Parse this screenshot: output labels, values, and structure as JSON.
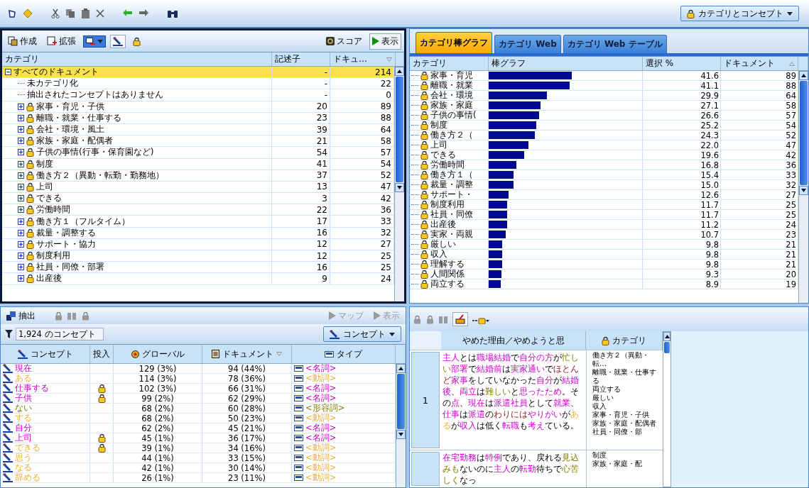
{
  "toolbar": {
    "view_menu": {
      "label": "カテゴリとコンセプト"
    }
  },
  "categories_pane": {
    "buttons": [
      {
        "label": "作成"
      },
      {
        "label": "拡張"
      }
    ],
    "right_buttons": [
      {
        "label": "スコア",
        "kind": "score"
      },
      {
        "label": "表示",
        "kind": "play"
      }
    ],
    "columns": [
      "カテゴリ",
      "記述子",
      "ドキュ…"
    ],
    "tree": [
      {
        "kind": "root",
        "label": "すべてのドキュメント",
        "descriptors": "-",
        "documents": "214",
        "expanded": true,
        "selected": true,
        "children": [
          {
            "kind": "plain",
            "label": "未カテゴリ化",
            "descriptors": "-",
            "documents": "22",
            "selected": false
          },
          {
            "kind": "plain",
            "label": "抽出されたコンセプトはありません",
            "descriptors": "-",
            "documents": "0",
            "selected": false
          },
          {
            "kind": "category",
            "label": "家事・育児・子供",
            "descriptors": "20",
            "documents": "89",
            "expanded": false,
            "selected": false
          },
          {
            "kind": "category",
            "label": "離職・就業・仕事する",
            "descriptors": "23",
            "documents": "88",
            "expanded": false,
            "selected": false
          },
          {
            "kind": "category",
            "label": "会社・環境・風土",
            "descriptors": "39",
            "documents": "64",
            "expanded": false,
            "selected": false
          },
          {
            "kind": "category",
            "label": "家族・家庭・配偶者",
            "descriptors": "21",
            "documents": "58",
            "expanded": false,
            "selected": false
          },
          {
            "kind": "category",
            "label": "子供の事情(行事・保育園など)",
            "descriptors": "54",
            "documents": "57",
            "expanded": false,
            "selected": false
          },
          {
            "kind": "category",
            "label": "制度",
            "descriptors": "41",
            "documents": "54",
            "expanded": false,
            "selected": false
          },
          {
            "kind": "category",
            "label": "働き方２（異動・転勤・勤務地）",
            "descriptors": "37",
            "documents": "52",
            "expanded": false,
            "selected": false
          },
          {
            "kind": "category",
            "label": "上司",
            "descriptors": "13",
            "documents": "47",
            "expanded": false,
            "selected": false
          },
          {
            "kind": "category",
            "label": "できる",
            "descriptors": "3",
            "documents": "42",
            "expanded": false,
            "selected": false
          },
          {
            "kind": "category",
            "label": "労働時間",
            "descriptors": "22",
            "documents": "36",
            "expanded": false,
            "selected": false
          },
          {
            "kind": "category",
            "label": "働き方１（フルタイム）",
            "descriptors": "17",
            "documents": "33",
            "expanded": false,
            "selected": false
          },
          {
            "kind": "category",
            "label": "裁量・調整する",
            "descriptors": "16",
            "documents": "32",
            "expanded": false,
            "selected": false
          },
          {
            "kind": "category",
            "label": "サポート・協力",
            "descriptors": "12",
            "documents": "27",
            "expanded": false,
            "selected": false
          },
          {
            "kind": "category",
            "label": "制度利用",
            "descriptors": "12",
            "documents": "25",
            "expanded": false,
            "selected": false
          },
          {
            "kind": "category",
            "label": "社員・同僚・部署",
            "descriptors": "16",
            "documents": "25",
            "expanded": false,
            "selected": false
          },
          {
            "kind": "category",
            "label": "出産後",
            "descriptors": "9",
            "documents": "24",
            "expanded": false,
            "selected": false
          }
        ]
      }
    ]
  },
  "chart_pane": {
    "tabs": [
      {
        "label": "カテゴリ棒グラフ",
        "selected": true
      },
      {
        "label": "カテゴリ Web",
        "selected": false
      },
      {
        "label": "カテゴリ Web テーブル",
        "selected": false
      }
    ],
    "columns": [
      "カテゴリ",
      "棒グラフ",
      "選択 %",
      "ドキュメント"
    ],
    "rows": [
      {
        "label": "家事・育児",
        "level": 0.54,
        "percent": "41.6",
        "documents": "89"
      },
      {
        "label": "離職・就業",
        "level": 0.53,
        "percent": "41.1",
        "documents": "88"
      },
      {
        "label": "会社・環境",
        "level": 0.38,
        "percent": "29.9",
        "documents": "64"
      },
      {
        "label": "家族・家庭",
        "level": 0.34,
        "percent": "27.1",
        "documents": "58"
      },
      {
        "label": "子供の事情(",
        "level": 0.33,
        "percent": "26.6",
        "documents": "57"
      },
      {
        "label": "制度",
        "level": 0.31,
        "percent": "25.2",
        "documents": "54"
      },
      {
        "label": "働き方２（",
        "level": 0.3,
        "percent": "24.3",
        "documents": "52"
      },
      {
        "label": "上司",
        "level": 0.26,
        "percent": "22.0",
        "documents": "47"
      },
      {
        "label": "できる",
        "level": 0.23,
        "percent": "19.6",
        "documents": "42"
      },
      {
        "label": "労働時間",
        "level": 0.18,
        "percent": "16.8",
        "documents": "36"
      },
      {
        "label": "働き方１（",
        "level": 0.16,
        "percent": "15.4",
        "documents": "33"
      },
      {
        "label": "裁量・調整",
        "level": 0.16,
        "percent": "15.0",
        "documents": "32"
      },
      {
        "label": "サポート・",
        "level": 0.13,
        "percent": "12.6",
        "documents": "27"
      },
      {
        "label": "制度利用",
        "level": 0.12,
        "percent": "11.7",
        "documents": "25"
      },
      {
        "label": "社員・同僚",
        "level": 0.12,
        "percent": "11.7",
        "documents": "25"
      },
      {
        "label": "出産後",
        "level": 0.12,
        "percent": "11.2",
        "documents": "24"
      },
      {
        "label": "実家・両親",
        "level": 0.11,
        "percent": "10.7",
        "documents": "23"
      },
      {
        "label": "厳しい",
        "level": 0.09,
        "percent": "9.8",
        "documents": "21"
      },
      {
        "label": "収入",
        "level": 0.09,
        "percent": "9.8",
        "documents": "21"
      },
      {
        "label": "理解する",
        "level": 0.09,
        "percent": "9.8",
        "documents": "21"
      },
      {
        "label": "人間関係",
        "level": 0.085,
        "percent": "9.3",
        "documents": "20"
      },
      {
        "label": "両立する",
        "level": 0.08,
        "percent": "8.9",
        "documents": "19"
      }
    ]
  },
  "concepts_pane": {
    "buttons": [
      {
        "label": "抽出",
        "disabled": false
      }
    ],
    "right_buttons": [
      {
        "label": "マップ",
        "disabled": true
      },
      {
        "label": "表示",
        "disabled": true
      }
    ],
    "filter": {
      "value": "1,924 のコンセプト"
    },
    "view_menu": {
      "label": "コンセプト"
    },
    "columns": [
      "コンセプト",
      "投入",
      "グローバル",
      "ドキュメント",
      "タイプ"
    ],
    "rows": [
      {
        "concept": "現在",
        "kind": "noun",
        "inserted": false,
        "global": "129 (3%)",
        "documents": "94 (44%)",
        "type": "<名詞>"
      },
      {
        "concept": "ある",
        "kind": "verb",
        "inserted": false,
        "global": "114 (3%)",
        "documents": "78 (36%)",
        "type": "<動詞>"
      },
      {
        "concept": "仕事する",
        "kind": "noun",
        "inserted": true,
        "global": "102 (3%)",
        "documents": "66 (31%)",
        "type": "<名詞>"
      },
      {
        "concept": "子供",
        "kind": "noun",
        "inserted": true,
        "global": "99 (2%)",
        "documents": "62 (29%)",
        "type": "<名詞>"
      },
      {
        "concept": "ない",
        "kind": "adjective",
        "inserted": false,
        "global": "68 (2%)",
        "documents": "60 (28%)",
        "type": "<形容詞>"
      },
      {
        "concept": "する",
        "kind": "verb",
        "inserted": false,
        "global": "68 (2%)",
        "documents": "50 (23%)",
        "type": "<動詞>"
      },
      {
        "concept": "自分",
        "kind": "noun",
        "inserted": false,
        "global": "62 (2%)",
        "documents": "45 (21%)",
        "type": "<名詞>"
      },
      {
        "concept": "上司",
        "kind": "noun",
        "inserted": true,
        "global": "45 (1%)",
        "documents": "36 (17%)",
        "type": "<名詞>"
      },
      {
        "concept": "できる",
        "kind": "verb",
        "inserted": true,
        "global": "39 (1%)",
        "documents": "34 (16%)",
        "type": "<動詞>"
      },
      {
        "concept": "思う",
        "kind": "verb",
        "inserted": false,
        "global": "44 (1%)",
        "documents": "33 (15%)",
        "type": "<動詞>"
      },
      {
        "concept": "なる",
        "kind": "verb",
        "inserted": false,
        "global": "42 (1%)",
        "documents": "30 (14%)",
        "type": "<動詞>"
      },
      {
        "concept": "辞める",
        "kind": "verb",
        "inserted": false,
        "global": "26 (1%)",
        "documents": "23 (11%)",
        "type": "<動詞>"
      }
    ]
  },
  "document_pane": {
    "columns": [
      "やめた理由／やめようと思",
      "カテゴリ"
    ],
    "rows": [
      {
        "number": "1",
        "segments": [
          {
            "text": "主人",
            "kind": "noun"
          },
          {
            "text": "とは",
            "kind": "plain"
          },
          {
            "text": "職場結婚",
            "kind": "noun"
          },
          {
            "text": "で",
            "kind": "plain"
          },
          {
            "text": "自分の方",
            "kind": "noun"
          },
          {
            "text": "が",
            "kind": "plain"
          },
          {
            "text": "忙しい",
            "kind": "adjective"
          },
          {
            "text": "部署",
            "kind": "noun"
          },
          {
            "text": "で",
            "kind": "plain"
          },
          {
            "text": "結婚前",
            "kind": "noun"
          },
          {
            "text": "は",
            "kind": "plain"
          },
          {
            "text": "実家通い",
            "kind": "noun"
          },
          {
            "text": "で",
            "kind": "plain"
          },
          {
            "text": "ほとんど",
            "kind": "other"
          },
          {
            "text": "家事",
            "kind": "noun"
          },
          {
            "text": "をしていなかった",
            "kind": "plain"
          },
          {
            "text": "自分",
            "kind": "noun"
          },
          {
            "text": "が",
            "kind": "plain"
          },
          {
            "text": "結婚後",
            "kind": "noun"
          },
          {
            "text": "、",
            "kind": "plain"
          },
          {
            "text": "両立",
            "kind": "noun"
          },
          {
            "text": "は",
            "kind": "plain"
          },
          {
            "text": "難しい",
            "kind": "adjective"
          },
          {
            "text": "と",
            "kind": "plain"
          },
          {
            "text": "思ったため",
            "kind": "noun"
          },
          {
            "text": "。その",
            "kind": "plain"
          },
          {
            "text": "点",
            "kind": "noun"
          },
          {
            "text": "、",
            "kind": "plain"
          },
          {
            "text": "現在",
            "kind": "noun"
          },
          {
            "text": "は",
            "kind": "plain"
          },
          {
            "text": "派遣社員",
            "kind": "noun"
          },
          {
            "text": "として",
            "kind": "plain"
          },
          {
            "text": "就業",
            "kind": "noun"
          },
          {
            "text": "、",
            "kind": "plain"
          },
          {
            "text": "仕事",
            "kind": "noun"
          },
          {
            "text": "は",
            "kind": "plain"
          },
          {
            "text": "派遣",
            "kind": "noun"
          },
          {
            "text": "の",
            "kind": "plain"
          },
          {
            "text": "わりには",
            "kind": "other"
          },
          {
            "text": "やりがい",
            "kind": "noun"
          },
          {
            "text": "が",
            "kind": "plain"
          },
          {
            "text": "ある",
            "kind": "verb"
          },
          {
            "text": "が",
            "kind": "plain"
          },
          {
            "text": "収入",
            "kind": "noun"
          },
          {
            "text": "は低く",
            "kind": "plain"
          },
          {
            "text": "転職",
            "kind": "noun"
          },
          {
            "text": "も",
            "kind": "plain"
          },
          {
            "text": "考え",
            "kind": "noun"
          },
          {
            "text": "ている。",
            "kind": "plain"
          }
        ],
        "categories": [
          "働き方２（異動・転…",
          "離職・就業・仕事する",
          "両立する",
          "厳しい",
          "収入",
          "家事・育児・子供",
          "家族・家庭・配偶者",
          "社員・同僚・部"
        ]
      },
      {
        "segments": [
          {
            "text": "在宅勤務",
            "kind": "noun"
          },
          {
            "text": "は",
            "kind": "plain"
          },
          {
            "text": "特例",
            "kind": "noun"
          },
          {
            "text": "であり、戻れる",
            "kind": "plain"
          },
          {
            "text": "見込みも",
            "kind": "adjective"
          },
          {
            "text": "ないのに",
            "kind": "plain"
          },
          {
            "text": "主人",
            "kind": "noun"
          },
          {
            "text": "の",
            "kind": "plain"
          },
          {
            "text": "転勤",
            "kind": "noun"
          },
          {
            "text": "待ちで",
            "kind": "plain"
          },
          {
            "text": "心苦しく",
            "kind": "adjective"
          },
          {
            "text": "なっ",
            "kind": "plain"
          }
        ],
        "categories": [
          "制度",
          "家族・家庭・配"
        ]
      }
    ]
  }
}
